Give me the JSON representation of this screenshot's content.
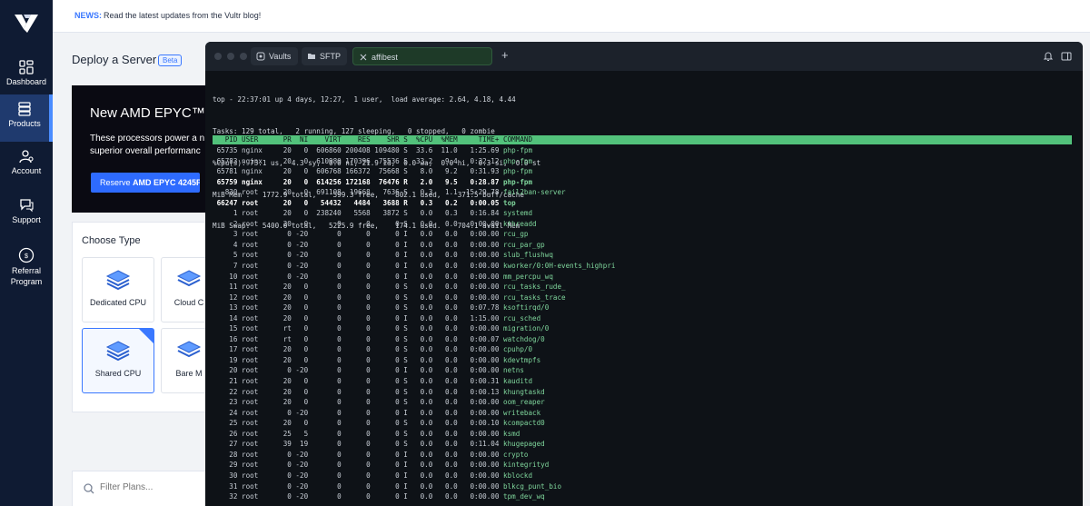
{
  "sidebar": {
    "items": [
      {
        "label": "Dashboard",
        "icon": "dashboard-icon"
      },
      {
        "label": "Products",
        "icon": "products-icon",
        "active": true
      },
      {
        "label": "Account",
        "icon": "account-icon"
      },
      {
        "label": "Support",
        "icon": "support-icon"
      },
      {
        "label": "Referral Program",
        "icon": "referral-icon"
      }
    ]
  },
  "news": {
    "label": "NEWS:",
    "text": "Read the latest updates from the Vultr blog!"
  },
  "page": {
    "title": "Deploy a Server",
    "badge": "Beta",
    "promo": {
      "title": "New AMD EPYC™ 4",
      "text_line1": "These processors power a n",
      "text_line2": "superior overall performanc",
      "button_prefix": "Reserve ",
      "button_bold": "AMD EPYC 4245P"
    },
    "choose_type": {
      "title": "Choose Type",
      "cards": [
        "Dedicated CPU",
        "Cloud C",
        "Shared CPU",
        "Bare M"
      ]
    },
    "filter_placeholder": "Filter Plans..."
  },
  "terminal": {
    "tabs": [
      {
        "label": "Vaults",
        "icon": "vault-icon"
      },
      {
        "label": "SFTP",
        "icon": "folder-icon"
      },
      {
        "label": "affibest",
        "icon": "close-icon",
        "active": true
      }
    ],
    "new_tab": "+",
    "summary": [
      "top - 22:37:01 up 4 days, 12:27,  1 user,  load average: 2.64, 4.18, 4.44",
      "Tasks: 129 total,   2 running, 127 sleeping,   0 stopped,   0 zombie",
      "%Cpu(s): 73.1 us,  4.3 sy,  0.0 ni, 21.9 id,  0.0 wa,  0.0 hi,  0.3 si,  0.0 st",
      "MiB Mem :   1772.9 total,    599.3 free,    802.1 used,    371.5 buff/cache",
      "MiB Swap:   5400.0 total,   5225.9 free,    174.1 used.    704.1 avail Mem"
    ],
    "header": "   PID USER      PR  NI    VIRT    RES    SHR S  %CPU  %MEM     TIME+ COMMAND",
    "processes": [
      {
        "pid": "65735",
        "user": "nginx",
        "pr": "20",
        "ni": "0",
        "virt": "606860",
        "res": "200408",
        "shr": "109480",
        "s": "S",
        "cpu": "33.6",
        "mem": "11.0",
        "time": "1:25.69",
        "cmd": "php-fpm",
        "bold": false
      },
      {
        "pid": "65783",
        "user": "nginx",
        "pr": "20",
        "ni": "0",
        "virt": "610980",
        "res": "170396",
        "shr": "75536",
        "s": "S",
        "cpu": "33.2",
        "mem": "9.4",
        "time": "0:32.12",
        "cmd": "php-fpm",
        "bold": false
      },
      {
        "pid": "65781",
        "user": "nginx",
        "pr": "20",
        "ni": "0",
        "virt": "606768",
        "res": "166372",
        "shr": "75668",
        "s": "S",
        "cpu": "8.0",
        "mem": "9.2",
        "time": "0:31.93",
        "cmd": "php-fpm",
        "bold": false
      },
      {
        "pid": "65759",
        "user": "nginx",
        "pr": "20",
        "ni": "0",
        "virt": "614256",
        "res": "172168",
        "shr": "76476",
        "s": "R",
        "cpu": "2.0",
        "mem": "9.5",
        "time": "0:28.87",
        "cmd": "php-fpm",
        "bold": true
      },
      {
        "pid": "830",
        "user": "root",
        "pr": "20",
        "ni": "0",
        "virt": "691108",
        "res": "19668",
        "shr": "7636",
        "s": "S",
        "cpu": "0.3",
        "mem": "1.1",
        "time": "15:29.78",
        "cmd": "fail2ban-server",
        "bold": false
      },
      {
        "pid": "66247",
        "user": "root",
        "pr": "20",
        "ni": "0",
        "virt": "54432",
        "res": "4484",
        "shr": "3688",
        "s": "R",
        "cpu": "0.3",
        "mem": "0.2",
        "time": "0:00.05",
        "cmd": "top",
        "bold": true
      },
      {
        "pid": "1",
        "user": "root",
        "pr": "20",
        "ni": "0",
        "virt": "238240",
        "res": "5568",
        "shr": "3872",
        "s": "S",
        "cpu": "0.0",
        "mem": "0.3",
        "time": "0:16.84",
        "cmd": "systemd",
        "bold": false
      },
      {
        "pid": "2",
        "user": "root",
        "pr": "20",
        "ni": "0",
        "virt": "0",
        "res": "0",
        "shr": "0",
        "s": "S",
        "cpu": "0.0",
        "mem": "0.0",
        "time": "0:00.00",
        "cmd": "kthreadd",
        "bold": false
      },
      {
        "pid": "3",
        "user": "root",
        "pr": "0",
        "ni": "-20",
        "virt": "0",
        "res": "0",
        "shr": "0",
        "s": "I",
        "cpu": "0.0",
        "mem": "0.0",
        "time": "0:00.00",
        "cmd": "rcu_gp",
        "bold": false
      },
      {
        "pid": "4",
        "user": "root",
        "pr": "0",
        "ni": "-20",
        "virt": "0",
        "res": "0",
        "shr": "0",
        "s": "I",
        "cpu": "0.0",
        "mem": "0.0",
        "time": "0:00.00",
        "cmd": "rcu_par_gp",
        "bold": false
      },
      {
        "pid": "5",
        "user": "root",
        "pr": "0",
        "ni": "-20",
        "virt": "0",
        "res": "0",
        "shr": "0",
        "s": "I",
        "cpu": "0.0",
        "mem": "0.0",
        "time": "0:00.00",
        "cmd": "slub_flushwq",
        "bold": false
      },
      {
        "pid": "7",
        "user": "root",
        "pr": "0",
        "ni": "-20",
        "virt": "0",
        "res": "0",
        "shr": "0",
        "s": "I",
        "cpu": "0.0",
        "mem": "0.0",
        "time": "0:00.00",
        "cmd": "kworker/0:0H-events_highpri",
        "bold": false
      },
      {
        "pid": "10",
        "user": "root",
        "pr": "0",
        "ni": "-20",
        "virt": "0",
        "res": "0",
        "shr": "0",
        "s": "I",
        "cpu": "0.0",
        "mem": "0.0",
        "time": "0:00.00",
        "cmd": "mm_percpu_wq",
        "bold": false
      },
      {
        "pid": "11",
        "user": "root",
        "pr": "20",
        "ni": "0",
        "virt": "0",
        "res": "0",
        "shr": "0",
        "s": "S",
        "cpu": "0.0",
        "mem": "0.0",
        "time": "0:00.00",
        "cmd": "rcu_tasks_rude_",
        "bold": false
      },
      {
        "pid": "12",
        "user": "root",
        "pr": "20",
        "ni": "0",
        "virt": "0",
        "res": "0",
        "shr": "0",
        "s": "S",
        "cpu": "0.0",
        "mem": "0.0",
        "time": "0:00.00",
        "cmd": "rcu_tasks_trace",
        "bold": false
      },
      {
        "pid": "13",
        "user": "root",
        "pr": "20",
        "ni": "0",
        "virt": "0",
        "res": "0",
        "shr": "0",
        "s": "S",
        "cpu": "0.0",
        "mem": "0.0",
        "time": "0:07.78",
        "cmd": "ksoftirqd/0",
        "bold": false
      },
      {
        "pid": "14",
        "user": "root",
        "pr": "20",
        "ni": "0",
        "virt": "0",
        "res": "0",
        "shr": "0",
        "s": "I",
        "cpu": "0.0",
        "mem": "0.0",
        "time": "1:15.00",
        "cmd": "rcu_sched",
        "bold": false
      },
      {
        "pid": "15",
        "user": "root",
        "pr": "rt",
        "ni": "0",
        "virt": "0",
        "res": "0",
        "shr": "0",
        "s": "S",
        "cpu": "0.0",
        "mem": "0.0",
        "time": "0:00.00",
        "cmd": "migration/0",
        "bold": false
      },
      {
        "pid": "16",
        "user": "root",
        "pr": "rt",
        "ni": "0",
        "virt": "0",
        "res": "0",
        "shr": "0",
        "s": "S",
        "cpu": "0.0",
        "mem": "0.0",
        "time": "0:00.07",
        "cmd": "watchdog/0",
        "bold": false
      },
      {
        "pid": "17",
        "user": "root",
        "pr": "20",
        "ni": "0",
        "virt": "0",
        "res": "0",
        "shr": "0",
        "s": "S",
        "cpu": "0.0",
        "mem": "0.0",
        "time": "0:00.00",
        "cmd": "cpuhp/0",
        "bold": false
      },
      {
        "pid": "19",
        "user": "root",
        "pr": "20",
        "ni": "0",
        "virt": "0",
        "res": "0",
        "shr": "0",
        "s": "S",
        "cpu": "0.0",
        "mem": "0.0",
        "time": "0:00.00",
        "cmd": "kdevtmpfs",
        "bold": false
      },
      {
        "pid": "20",
        "user": "root",
        "pr": "0",
        "ni": "-20",
        "virt": "0",
        "res": "0",
        "shr": "0",
        "s": "I",
        "cpu": "0.0",
        "mem": "0.0",
        "time": "0:00.00",
        "cmd": "netns",
        "bold": false
      },
      {
        "pid": "21",
        "user": "root",
        "pr": "20",
        "ni": "0",
        "virt": "0",
        "res": "0",
        "shr": "0",
        "s": "S",
        "cpu": "0.0",
        "mem": "0.0",
        "time": "0:00.31",
        "cmd": "kauditd",
        "bold": false
      },
      {
        "pid": "22",
        "user": "root",
        "pr": "20",
        "ni": "0",
        "virt": "0",
        "res": "0",
        "shr": "0",
        "s": "S",
        "cpu": "0.0",
        "mem": "0.0",
        "time": "0:00.13",
        "cmd": "khungtaskd",
        "bold": false
      },
      {
        "pid": "23",
        "user": "root",
        "pr": "20",
        "ni": "0",
        "virt": "0",
        "res": "0",
        "shr": "0",
        "s": "S",
        "cpu": "0.0",
        "mem": "0.0",
        "time": "0:00.00",
        "cmd": "oom_reaper",
        "bold": false
      },
      {
        "pid": "24",
        "user": "root",
        "pr": "0",
        "ni": "-20",
        "virt": "0",
        "res": "0",
        "shr": "0",
        "s": "I",
        "cpu": "0.0",
        "mem": "0.0",
        "time": "0:00.00",
        "cmd": "writeback",
        "bold": false
      },
      {
        "pid": "25",
        "user": "root",
        "pr": "20",
        "ni": "0",
        "virt": "0",
        "res": "0",
        "shr": "0",
        "s": "S",
        "cpu": "0.0",
        "mem": "0.0",
        "time": "0:00.10",
        "cmd": "kcompactd0",
        "bold": false
      },
      {
        "pid": "26",
        "user": "root",
        "pr": "25",
        "ni": "5",
        "virt": "0",
        "res": "0",
        "shr": "0",
        "s": "S",
        "cpu": "0.0",
        "mem": "0.0",
        "time": "0:00.00",
        "cmd": "ksmd",
        "bold": false
      },
      {
        "pid": "27",
        "user": "root",
        "pr": "39",
        "ni": "19",
        "virt": "0",
        "res": "0",
        "shr": "0",
        "s": "S",
        "cpu": "0.0",
        "mem": "0.0",
        "time": "0:11.04",
        "cmd": "khugepaged",
        "bold": false
      },
      {
        "pid": "28",
        "user": "root",
        "pr": "0",
        "ni": "-20",
        "virt": "0",
        "res": "0",
        "shr": "0",
        "s": "I",
        "cpu": "0.0",
        "mem": "0.0",
        "time": "0:00.00",
        "cmd": "crypto",
        "bold": false
      },
      {
        "pid": "29",
        "user": "root",
        "pr": "0",
        "ni": "-20",
        "virt": "0",
        "res": "0",
        "shr": "0",
        "s": "I",
        "cpu": "0.0",
        "mem": "0.0",
        "time": "0:00.00",
        "cmd": "kintegrityd",
        "bold": false
      },
      {
        "pid": "30",
        "user": "root",
        "pr": "0",
        "ni": "-20",
        "virt": "0",
        "res": "0",
        "shr": "0",
        "s": "I",
        "cpu": "0.0",
        "mem": "0.0",
        "time": "0:00.00",
        "cmd": "kblockd",
        "bold": false
      },
      {
        "pid": "31",
        "user": "root",
        "pr": "0",
        "ni": "-20",
        "virt": "0",
        "res": "0",
        "shr": "0",
        "s": "I",
        "cpu": "0.0",
        "mem": "0.0",
        "time": "0:00.00",
        "cmd": "blkcg_punt_bio",
        "bold": false
      },
      {
        "pid": "32",
        "user": "root",
        "pr": "0",
        "ni": "-20",
        "virt": "0",
        "res": "0",
        "shr": "0",
        "s": "I",
        "cpu": "0.0",
        "mem": "0.0",
        "time": "0:00.00",
        "cmd": "tpm_dev_wq",
        "bold": false
      }
    ]
  },
  "colors": {
    "sidebar_bg": "#0f1b33",
    "accent": "#3a78ff",
    "terminal_bg": "#0e1217",
    "top_header": "#52c27b"
  }
}
